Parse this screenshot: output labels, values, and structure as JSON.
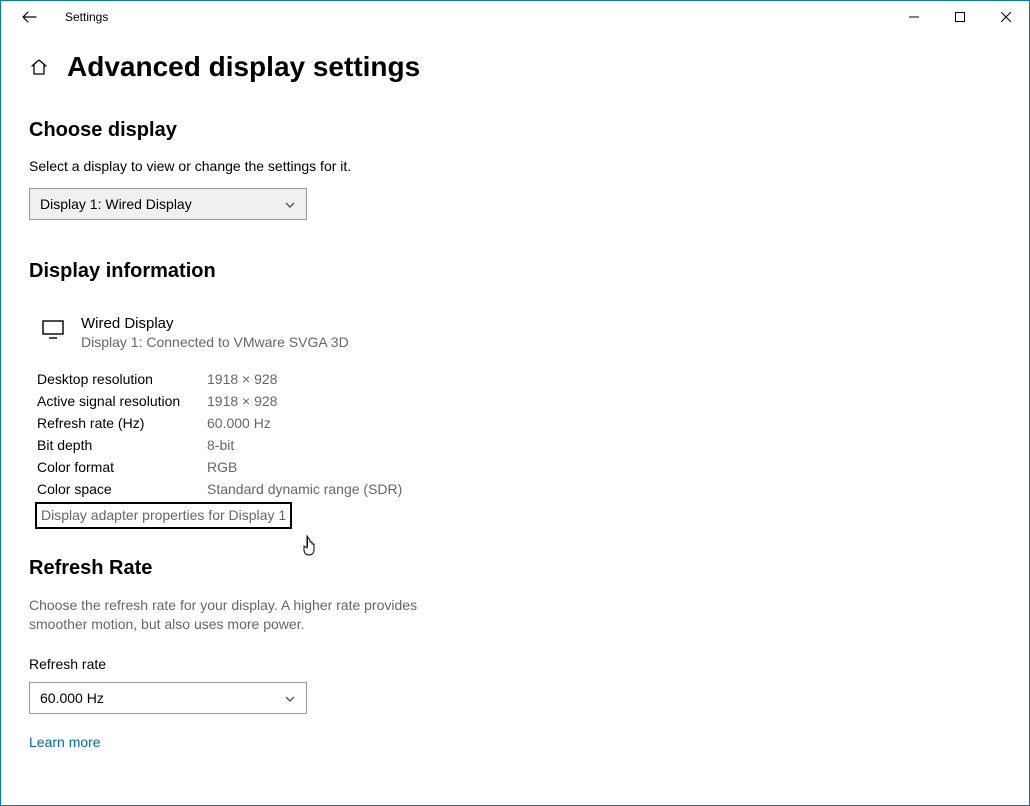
{
  "titlebar": {
    "title": "Settings"
  },
  "page": {
    "title": "Advanced display settings"
  },
  "choose_display": {
    "heading": "Choose display",
    "description": "Select a display to view or change the settings for it.",
    "selected": "Display 1: Wired Display"
  },
  "display_info": {
    "heading": "Display information",
    "name": "Wired Display",
    "connection": "Display 1: Connected to VMware SVGA 3D",
    "rows": {
      "desktop_res_label": "Desktop resolution",
      "desktop_res_value": "1918 × 928",
      "active_res_label": "Active signal resolution",
      "active_res_value": "1918 × 928",
      "refresh_label": "Refresh rate (Hz)",
      "refresh_value": "60.000 Hz",
      "bitdepth_label": "Bit depth",
      "bitdepth_value": "8-bit",
      "colorformat_label": "Color format",
      "colorformat_value": "RGB",
      "colorspace_label": "Color space",
      "colorspace_value": "Standard dynamic range (SDR)"
    },
    "adapter_link": "Display adapter properties for Display 1"
  },
  "refresh_rate": {
    "heading": "Refresh Rate",
    "description": "Choose the refresh rate for your display. A higher rate provides smoother motion, but also uses more power.",
    "field_label": "Refresh rate",
    "selected": "60.000 Hz",
    "learn_more": "Learn more"
  }
}
